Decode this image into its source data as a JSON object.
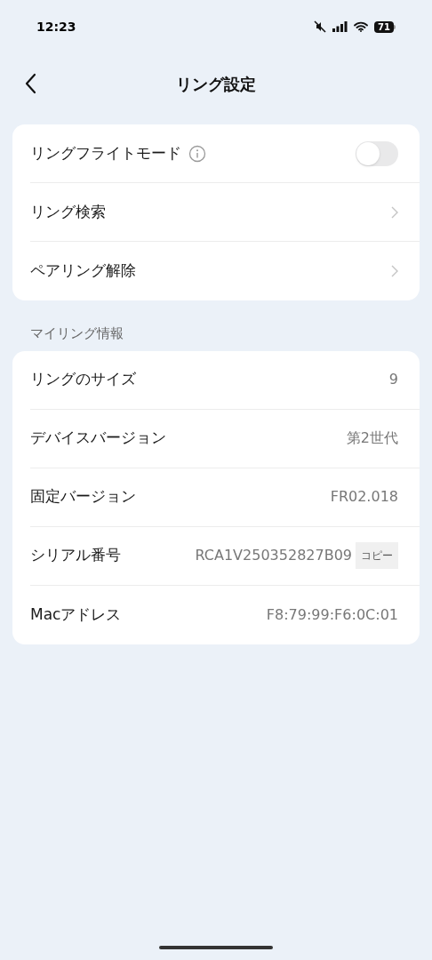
{
  "status_bar": {
    "time": "12:23",
    "battery": "71"
  },
  "header": {
    "title": "リング設定"
  },
  "settings": [
    {
      "kind": "toggle",
      "label": "リングフライトモード",
      "info": true,
      "on": false
    },
    {
      "kind": "link",
      "label": "リング検索"
    },
    {
      "kind": "link",
      "label": "ペアリング解除"
    }
  ],
  "info_section": {
    "title": "マイリング情報",
    "rows": [
      {
        "label": "リングのサイズ",
        "value": "9"
      },
      {
        "label": "デバイスバージョン",
        "value": "第2世代"
      },
      {
        "label": "固定バージョン",
        "value": "FR02.018"
      },
      {
        "label": "シリアル番号",
        "value": "RCA1V250352827B09",
        "action": "コピー"
      },
      {
        "label": "Macアドレス",
        "value": "F8:79:99:F6:0C:01"
      }
    ]
  }
}
